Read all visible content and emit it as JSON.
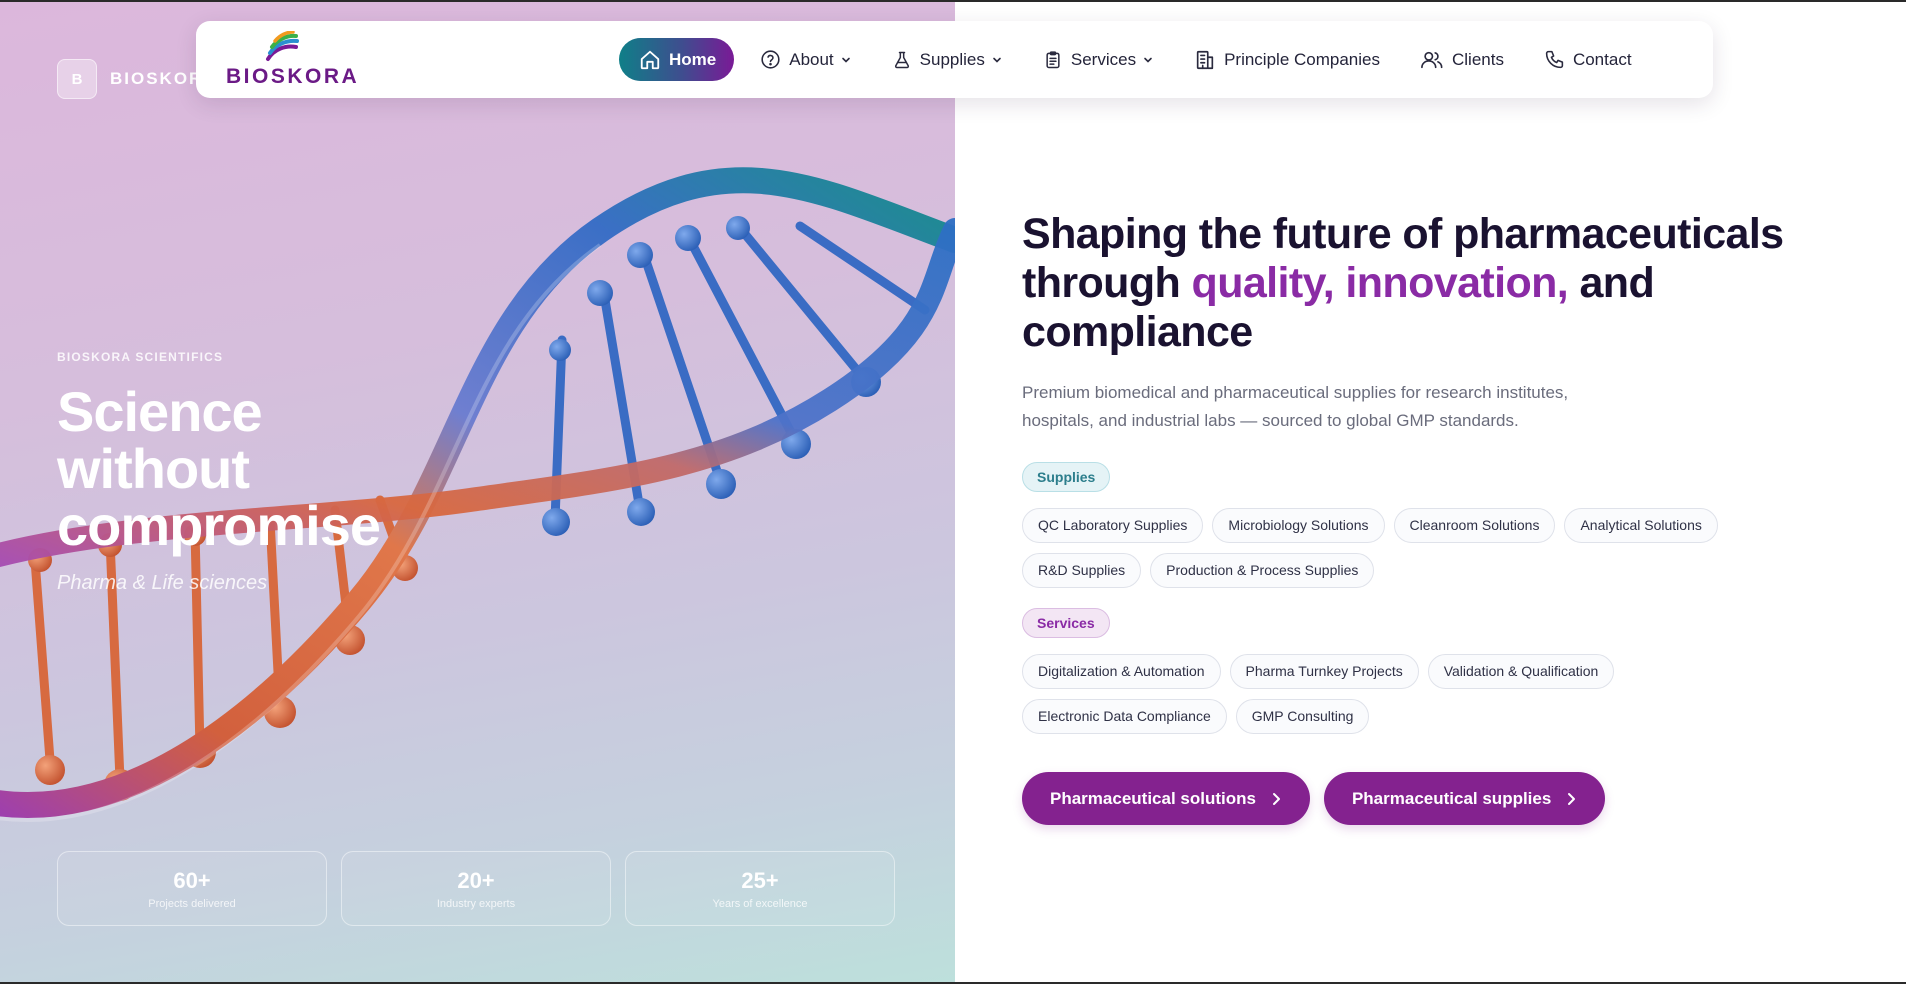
{
  "brand": {
    "mark": "B",
    "name": "BIOSKORA",
    "logo_text": "BIOSKORA"
  },
  "nav": {
    "items": [
      {
        "label": "Home",
        "icon": "home-icon",
        "active": true
      },
      {
        "label": "About",
        "icon": "help-circle-icon",
        "dropdown": true
      },
      {
        "label": "Supplies",
        "icon": "flask-icon",
        "dropdown": true
      },
      {
        "label": "Services",
        "icon": "clipboard-icon",
        "dropdown": true
      },
      {
        "label": "Principle Companies",
        "icon": "building-icon"
      },
      {
        "label": "Clients",
        "icon": "users-icon"
      },
      {
        "label": "Contact",
        "icon": "phone-icon"
      }
    ]
  },
  "hero": {
    "eyebrow": "BIOSKORA SCIENTIFICS",
    "title_lines": [
      "Science",
      "without",
      "compromise"
    ],
    "subtitle": "Pharma & Life sciences",
    "stats": [
      {
        "value": "60+",
        "label": "Projects delivered"
      },
      {
        "value": "20+",
        "label": "Industry experts"
      },
      {
        "value": "25+",
        "label": "Years of excellence"
      }
    ]
  },
  "main": {
    "headline_part1": "Shaping the future of pharmaceuticals through ",
    "headline_accent": "quality, innovation,",
    "headline_part2": " and compliance",
    "lead": "Premium biomedical and pharmaceutical supplies for research institutes, hospitals, and industrial labs — sourced to global GMP standards.",
    "supplies_tag": "Supplies",
    "supplies": [
      "QC Laboratory Supplies",
      "Microbiology Solutions",
      "Cleanroom Solutions",
      "Analytical Solutions",
      "R&D Supplies",
      "Production & Process Supplies"
    ],
    "services_tag": "Services",
    "services": [
      "Digitalization & Automation",
      "Pharma Turnkey Projects",
      "Validation & Qualification",
      "Electronic Data Compliance",
      "GMP Consulting"
    ],
    "cta_primary": "Pharmaceutical solutions",
    "cta_secondary": "Pharmaceutical supplies"
  },
  "colors": {
    "accent": "#8a2ba5",
    "cta": "#84228f",
    "teal": "#0f7f88",
    "logo": "#6b1a86"
  }
}
